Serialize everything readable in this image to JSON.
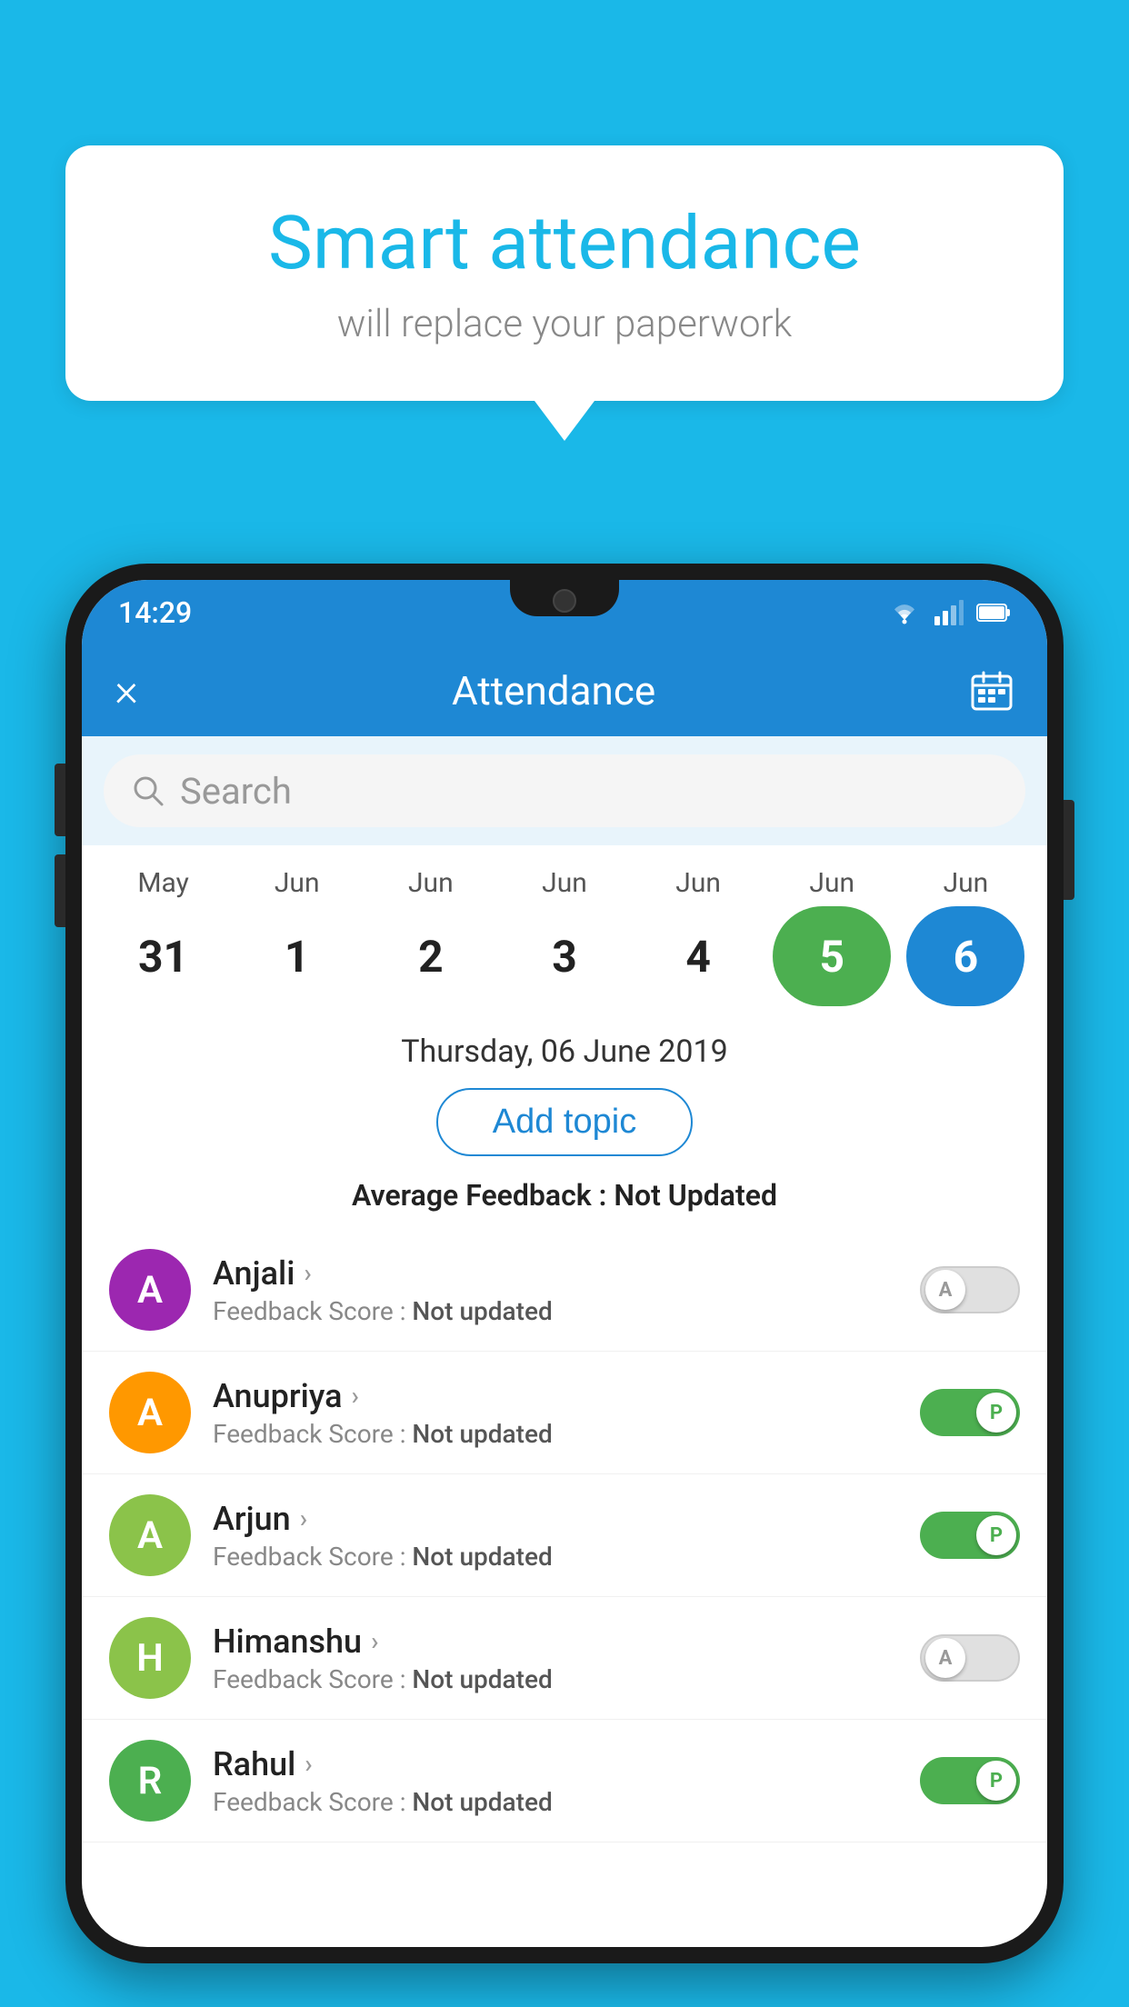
{
  "background_color": "#1ab8e8",
  "speech_bubble": {
    "title": "Smart attendance",
    "subtitle": "will replace your paperwork"
  },
  "status_bar": {
    "time": "14:29",
    "wifi": true,
    "signal": true,
    "battery": true
  },
  "app_header": {
    "title": "Attendance",
    "close_label": "×",
    "calendar_icon": "calendar-icon"
  },
  "search": {
    "placeholder": "Search"
  },
  "calendar": {
    "months": [
      "May",
      "Jun",
      "Jun",
      "Jun",
      "Jun",
      "Jun",
      "Jun"
    ],
    "dates": [
      {
        "date": "31",
        "state": "normal"
      },
      {
        "date": "1",
        "state": "normal"
      },
      {
        "date": "2",
        "state": "normal"
      },
      {
        "date": "3",
        "state": "normal"
      },
      {
        "date": "4",
        "state": "normal"
      },
      {
        "date": "5",
        "state": "today"
      },
      {
        "date": "6",
        "state": "selected"
      }
    ]
  },
  "selected_date": "Thursday, 06 June 2019",
  "add_topic_label": "Add topic",
  "avg_feedback": {
    "label": "Average Feedback : ",
    "value": "Not Updated"
  },
  "students": [
    {
      "name": "Anjali",
      "avatar_letter": "A",
      "avatar_color": "#9c27b0",
      "feedback_label": "Feedback Score : ",
      "feedback_value": "Not updated",
      "toggle_state": "off",
      "toggle_letter": "A"
    },
    {
      "name": "Anupriya",
      "avatar_letter": "A",
      "avatar_color": "#ff9800",
      "feedback_label": "Feedback Score : ",
      "feedback_value": "Not updated",
      "toggle_state": "on",
      "toggle_letter": "P"
    },
    {
      "name": "Arjun",
      "avatar_letter": "A",
      "avatar_color": "#8bc34a",
      "feedback_label": "Feedback Score : ",
      "feedback_value": "Not updated",
      "toggle_state": "on",
      "toggle_letter": "P"
    },
    {
      "name": "Himanshu",
      "avatar_letter": "H",
      "avatar_color": "#8bc34a",
      "feedback_label": "Feedback Score : ",
      "feedback_value": "Not updated",
      "toggle_state": "off",
      "toggle_letter": "A"
    },
    {
      "name": "Rahul",
      "avatar_letter": "R",
      "avatar_color": "#4caf50",
      "feedback_label": "Feedback Score : ",
      "feedback_value": "Not updated",
      "toggle_state": "on",
      "toggle_letter": "P"
    }
  ]
}
